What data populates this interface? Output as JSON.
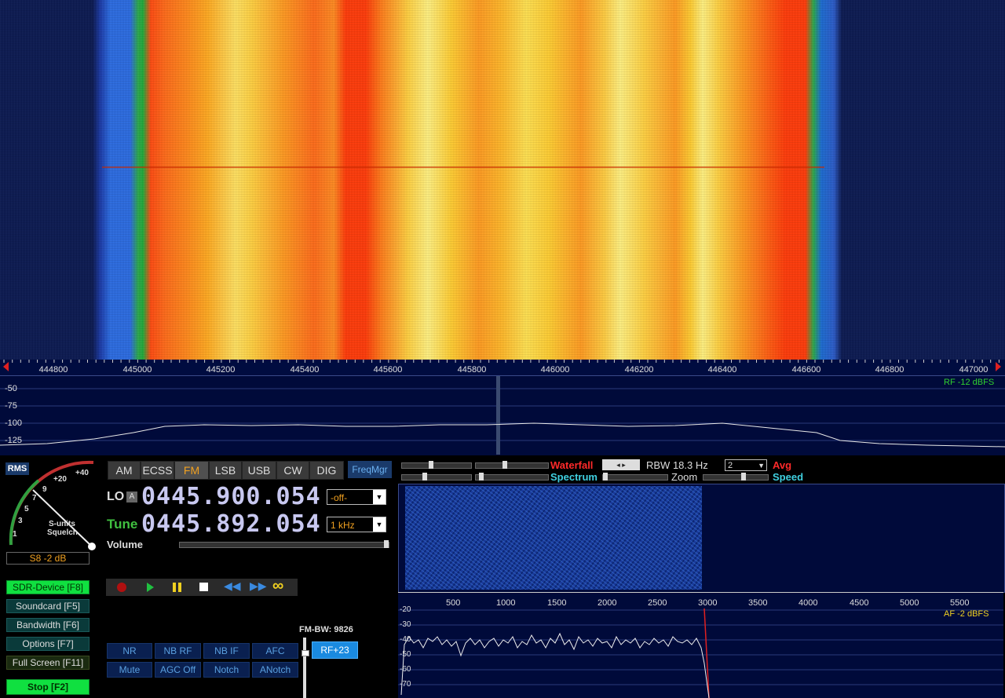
{
  "freq_axis": {
    "ticks": [
      "444800",
      "445000",
      "445200",
      "445400",
      "445600",
      "445800",
      "446000",
      "446200",
      "446400",
      "446600",
      "446800",
      "447000"
    ]
  },
  "rf_spectrum": {
    "db_labels": [
      "-50",
      "-75",
      "-100",
      "-125"
    ],
    "level": "RF -12 dBFS"
  },
  "smeter": {
    "rms_label": "RMS",
    "scale": [
      "+40",
      "+20",
      "9",
      "7",
      "5",
      "3",
      "1"
    ],
    "caption1": "S-units",
    "caption2": "Squelch",
    "reading": "S8 -2 dB"
  },
  "modes": [
    "AM",
    "ECSS",
    "FM",
    "LSB",
    "USB",
    "CW",
    "DIG"
  ],
  "active_mode": "FM",
  "freqmgr": "FreqMgr",
  "lo": {
    "label": "LO",
    "badge": "A",
    "value": "0445.900.054",
    "select": "-off-"
  },
  "tune": {
    "label": "Tune",
    "value": "0445.892.054",
    "select": "1 kHz"
  },
  "volume_label": "Volume",
  "side_buttons": [
    {
      "label": "SDR-Device [F8]",
      "green": true
    },
    {
      "label": "Soundcard  [F5]",
      "green": false
    },
    {
      "label": "Bandwidth  [F6]",
      "green": false
    },
    {
      "label": "Options    [F7]",
      "green": false
    },
    {
      "label": "Full Screen [F11]",
      "green": false
    },
    {
      "label": "Stop        [F2]",
      "green": true
    }
  ],
  "transport_icons": [
    "record-icon",
    "play-icon",
    "pause-icon",
    "stop-icon",
    "rewind-icon",
    "fast-forward-icon",
    "loop-icon"
  ],
  "fm_bw": "FM-BW: 9826",
  "dsp_row1": [
    "NR",
    "NB RF",
    "NB IF",
    "AFC"
  ],
  "dsp_row2": [
    "Mute",
    "AGC Off",
    "Notch",
    "ANotch"
  ],
  "rf_gain": "RF+23",
  "af_controls": {
    "waterfall_label": "Waterfall",
    "rbw": "RBW 18.3 Hz",
    "avg_value": "2",
    "avg_label": "Avg",
    "spectrum_label": "Spectrum",
    "zoom_label": "Zoom",
    "speed_label": "Speed"
  },
  "af_axis": [
    "500",
    "1000",
    "1500",
    "2000",
    "2500",
    "3000",
    "3500",
    "4000",
    "4500",
    "5000",
    "5500"
  ],
  "af_spectrum": {
    "db_labels": [
      "-20",
      "-30",
      "-40",
      "-50",
      "-60",
      "-70"
    ],
    "level": "AF -2 dBFS"
  },
  "colors": {
    "accent_orange": "#f0a020",
    "green": "#10e040",
    "cyan": "#40d0e0",
    "red": "#ff2a2a"
  }
}
